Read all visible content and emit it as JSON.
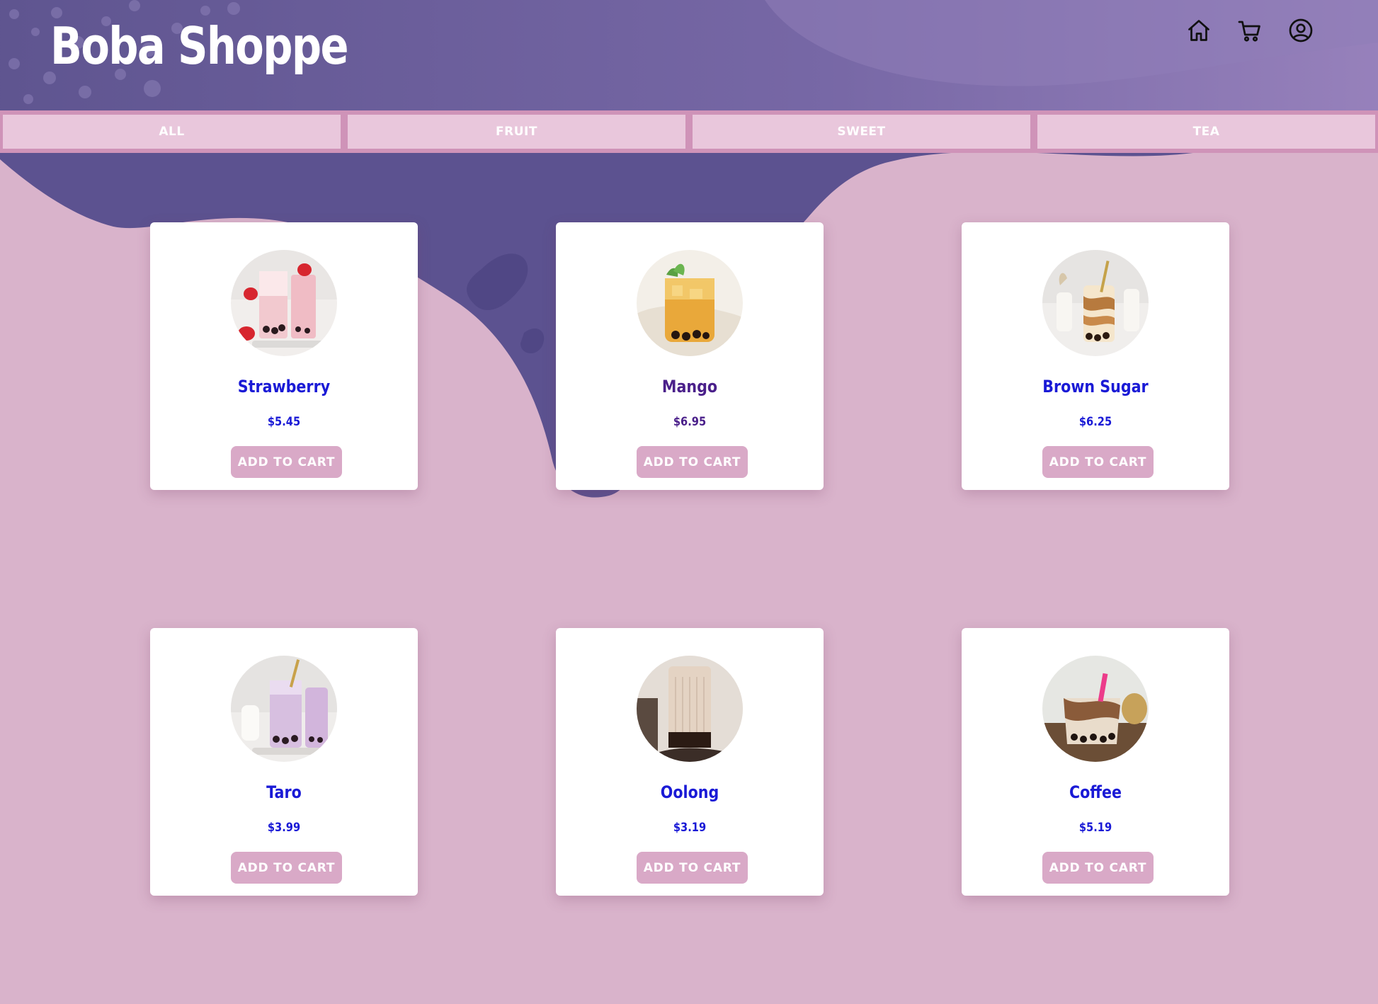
{
  "header": {
    "brand": "Boba Shoppe",
    "icons": [
      "home-icon",
      "cart-icon",
      "account-icon"
    ]
  },
  "tabs": [
    {
      "label": "ALL"
    },
    {
      "label": "FRUIT"
    },
    {
      "label": "SWEET"
    },
    {
      "label": "TEA"
    }
  ],
  "products": [
    {
      "name": "Strawberry",
      "price": "$5.45",
      "button": "ADD TO CART",
      "image": "strawberry-boba-image"
    },
    {
      "name": "Mango",
      "price": "$6.95",
      "button": "ADD TO CART",
      "image": "mango-boba-image"
    },
    {
      "name": "Brown Sugar",
      "price": "$6.25",
      "button": "ADD TO CART",
      "image": "brown-sugar-boba-image"
    },
    {
      "name": "Taro",
      "price": "$3.99",
      "button": "ADD TO CART",
      "image": "taro-boba-image"
    },
    {
      "name": "Oolong",
      "price": "$3.19",
      "button": "ADD TO CART",
      "image": "oolong-boba-image"
    },
    {
      "name": "Coffee",
      "price": "$5.19",
      "button": "ADD TO CART",
      "image": "coffee-boba-image"
    }
  ],
  "colors": {
    "background": "#d9b3cb",
    "header_purple": "#6a5e9a",
    "blob_purple": "#5c5290",
    "tab_bar": "#cf93b8",
    "tab": "#e9c7dc",
    "button": "#d9a9c7",
    "product_text": "#1a1ad6",
    "product_text_hover": "#4a1f8a"
  }
}
